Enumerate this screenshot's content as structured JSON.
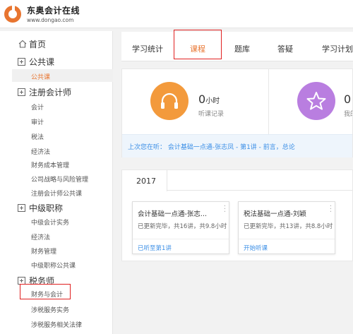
{
  "header": {
    "title": "东奥会计在线",
    "url": "www.dongao.com"
  },
  "sidebar": {
    "home": "首页",
    "sections": [
      {
        "label": "公共课",
        "items": [
          "公共课"
        ]
      },
      {
        "label": "注册会计师",
        "items": [
          "会计",
          "审计",
          "税法",
          "经济法",
          "财务成本管理",
          "公司战略与风险管理",
          "注册会计师公共课"
        ]
      },
      {
        "label": "中级职称",
        "items": [
          "中级会计实务",
          "经济法",
          "财务管理",
          "中级职称公共课"
        ]
      },
      {
        "label": "税务师",
        "items": [
          "财务与会计",
          "涉税服务实务",
          "涉税服务相关法律"
        ]
      }
    ]
  },
  "tabs": [
    "学习统计",
    "课程",
    "题库",
    "答疑",
    "学习计划"
  ],
  "active_tab": "课程",
  "stats": {
    "hours_value": "0",
    "hours_unit": "小时",
    "hours_label": "听课记录",
    "second_value": "0",
    "second_label": "我的"
  },
  "recent": {
    "text": "上次您在听： 会计基础一点通-张志凤 - 第1讲 - 前言，总论"
  },
  "year": "2017",
  "courses": [
    {
      "title": "会计基础一点通-张志...",
      "meta": "已更新完毕，共16讲，共9.8小时",
      "action": "已听至第1讲"
    },
    {
      "title": "税法基础一点通-刘颖",
      "meta": "已更新完毕，共13讲，共8.8小时",
      "action": "开始听课"
    }
  ],
  "colors": {
    "accent": "#e87530",
    "headphone_circle": "#f39a3c",
    "star_circle": "#b97ee0",
    "link": "#3a8ee6",
    "highlight_box": "#e02020"
  }
}
